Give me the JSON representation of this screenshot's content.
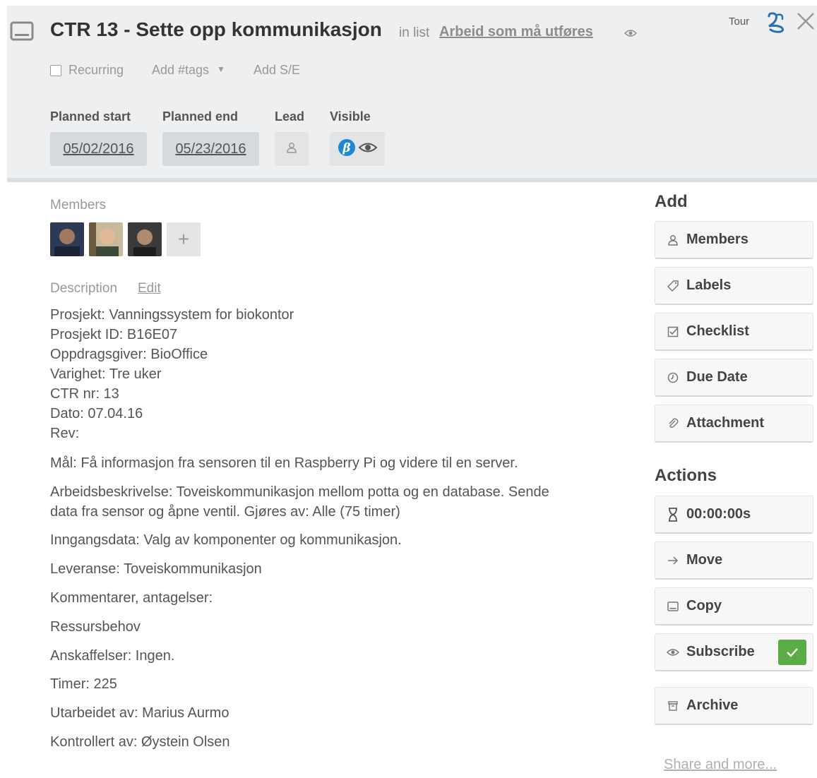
{
  "header": {
    "title": "CTR 13 - Sette opp kommunikasjon",
    "in_list_prefix": "in list",
    "list_name": "Arbeid som må utføres",
    "tour_label": "Tour"
  },
  "controls": {
    "recurring_label": "Recurring",
    "recurring_checked": false,
    "tags_label": "Add #tags",
    "tags_caret": "▼",
    "add_se_label": "Add S/E"
  },
  "fields": {
    "planned_start_label": "Planned start",
    "planned_start_value": "05/02/2016",
    "planned_end_label": "Planned end",
    "planned_end_value": "05/23/2016",
    "lead_label": "Lead",
    "visible_label": "Visible"
  },
  "members": {
    "label": "Members",
    "avatars": [
      "member-avatar-1",
      "member-avatar-2",
      "member-avatar-3"
    ],
    "add_symbol": "+"
  },
  "description": {
    "label": "Description",
    "edit_label": "Edit",
    "lines": [
      "Prosjekt: Vanningssystem for biokontor",
      "Prosjekt ID: B16E07",
      "Oppdragsgiver: BioOffice",
      "Varighet: Tre uker",
      "CTR nr: 13",
      "Dato: 07.04.16",
      "Rev:",
      "Mål: Få informasjon fra sensoren til en Raspberry Pi og videre til en server.",
      "Arbeidsbeskrivelse: Toveiskommunikasjon mellom potta og en database. Sende",
      "data fra sensor og åpne ventil. Gjøres av: Alle (75 timer)",
      "Inngangsdata: Valg av komponenter og kommunikasjon.",
      "Leveranse: Toveiskommunikasjon",
      "Kommentarer, antagelser:",
      "Ressursbehov",
      "Anskaffelser: Ingen.",
      "Timer: 225",
      "Utarbeidet av: Marius Aurmo",
      "Kontrollert av: Øystein Olsen"
    ]
  },
  "sidebar": {
    "add_heading": "Add",
    "add_buttons": [
      {
        "label": "Members",
        "icon": "person-icon"
      },
      {
        "label": "Labels",
        "icon": "tag-icon"
      },
      {
        "label": "Checklist",
        "icon": "checklist-icon"
      },
      {
        "label": "Due Date",
        "icon": "clock-icon"
      },
      {
        "label": "Attachment",
        "icon": "paperclip-icon"
      }
    ],
    "actions_heading": "Actions",
    "action_buttons": [
      {
        "label": "00:00:00s",
        "icon": "hourglass-icon"
      },
      {
        "label": "Move",
        "icon": "arrow-right-icon"
      },
      {
        "label": "Copy",
        "icon": "card-icon"
      },
      {
        "label": "Subscribe",
        "icon": "eye-icon",
        "subscribed": true
      },
      {
        "label": "Archive",
        "icon": "archive-icon"
      }
    ],
    "share_label": "Share and more..."
  },
  "colors": {
    "header_bg": "#edeff0",
    "subscribe_check": "#5aac44",
    "evernote_badge": "#1e88d3"
  }
}
